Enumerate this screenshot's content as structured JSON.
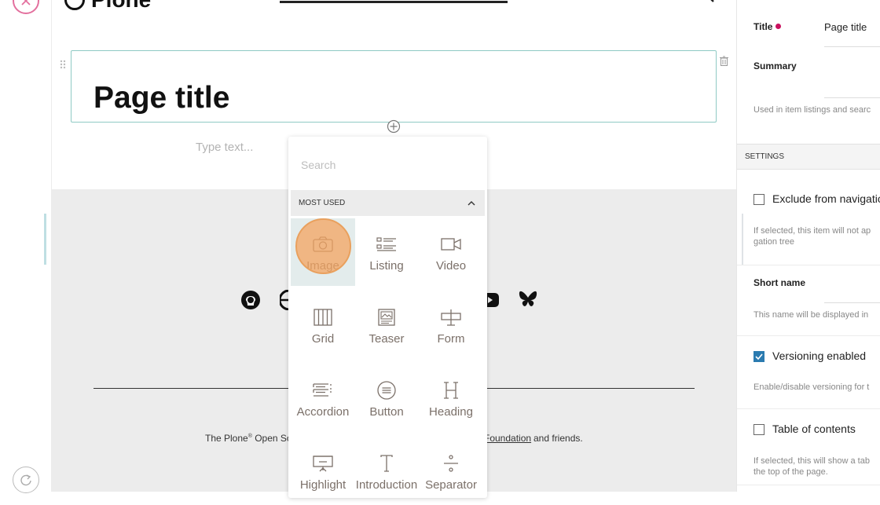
{
  "left_toolbar": {
    "close_icon": "close-icon",
    "redo_icon": "redo-icon"
  },
  "header": {
    "logo_text": "Plone"
  },
  "title_block": {
    "title": "Page title"
  },
  "text_block": {
    "placeholder": "Type text..."
  },
  "block_chooser": {
    "search_placeholder": "Search",
    "section_label": "MOST USED",
    "blocks": [
      {
        "label": "Image",
        "icon": "camera-icon"
      },
      {
        "label": "Listing",
        "icon": "list-icon"
      },
      {
        "label": "Video",
        "icon": "video-icon"
      },
      {
        "label": "Grid",
        "icon": "grid-icon"
      },
      {
        "label": "Teaser",
        "icon": "teaser-icon"
      },
      {
        "label": "Form",
        "icon": "form-icon"
      },
      {
        "label": "Accordion",
        "icon": "accordion-icon"
      },
      {
        "label": "Button",
        "icon": "button-icon"
      },
      {
        "label": "Heading",
        "icon": "heading-icon"
      },
      {
        "label": "Highlight",
        "icon": "highlight-icon"
      },
      {
        "label": "Introduction",
        "icon": "introduction-icon"
      },
      {
        "label": "Separator",
        "icon": "separator-icon"
      }
    ]
  },
  "footer": {
    "text_prefix": "The Plone",
    "text_mid": " Open So",
    "link_text": "Foundation",
    "text_suffix": "and friends.",
    "social_icons": [
      "github-icon",
      "globe-icon",
      "youtube-icon",
      "bluesky-icon"
    ]
  },
  "sidebar": {
    "title_label": "Title",
    "title_value": "Page title",
    "summary_label": "Summary",
    "summary_hint": "Used in item listings and searc",
    "settings_label": "SETTINGS",
    "exclude_label": "Exclude from navigatio",
    "exclude_hint_1": "If selected, this item will not ap",
    "exclude_hint_2": "gation tree",
    "short_name_label": "Short name",
    "short_name_hint": "This name will be displayed in",
    "versioning_label": "Versioning enabled",
    "versioning_checked": true,
    "versioning_hint": "Enable/disable versioning for t",
    "toc_label": "Table of contents",
    "toc_hint_1": "If selected, this will show a tab",
    "toc_hint_2": "the top of the page."
  },
  "colors": {
    "accent_teal": "#8fcac4",
    "required_dot": "#c9105e",
    "checkbox_blue": "#2b7bb0",
    "close_pink": "#e3709e",
    "click_highlight": "#f4a460"
  }
}
